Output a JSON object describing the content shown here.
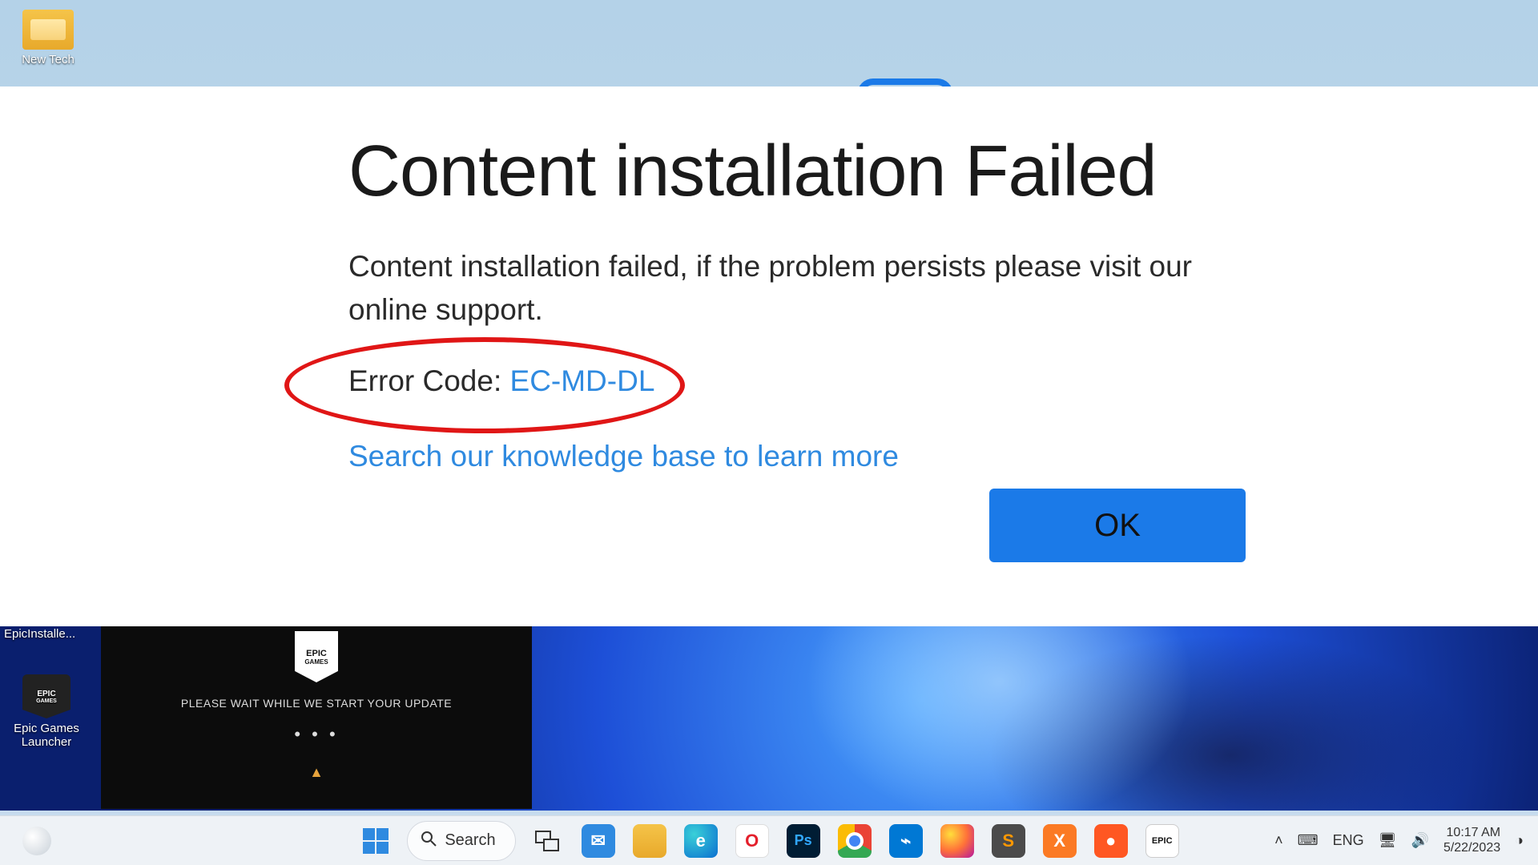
{
  "desktop": {
    "icons": [
      {
        "label": "New Tech"
      },
      {
        "label": "EpicInstalle..."
      },
      {
        "label": "Epic Games Launcher"
      }
    ]
  },
  "epic_badge": {
    "line1": "EPIC",
    "line2": "GAMES"
  },
  "updater": {
    "message": "PLEASE WAIT WHILE WE START YOUR UPDATE",
    "dots": "• • •",
    "warning_glyph": "▲"
  },
  "dialog": {
    "title": "Content installation Failed",
    "body": "Content installation failed, if the problem persists please visit our online support.",
    "error_prefix": "Error Code: ",
    "error_code": "EC-MD-DL",
    "kb_link": "Search our knowledge base to learn more",
    "ok_label": "OK"
  },
  "taskbar": {
    "search_label": "Search",
    "tray": {
      "lang": "ENG",
      "time": "10:17 AM",
      "date": "5/22/2023"
    }
  },
  "colors": {
    "accent": "#1b7ae8",
    "link": "#2f8ae0",
    "annotation": "#e01616"
  }
}
